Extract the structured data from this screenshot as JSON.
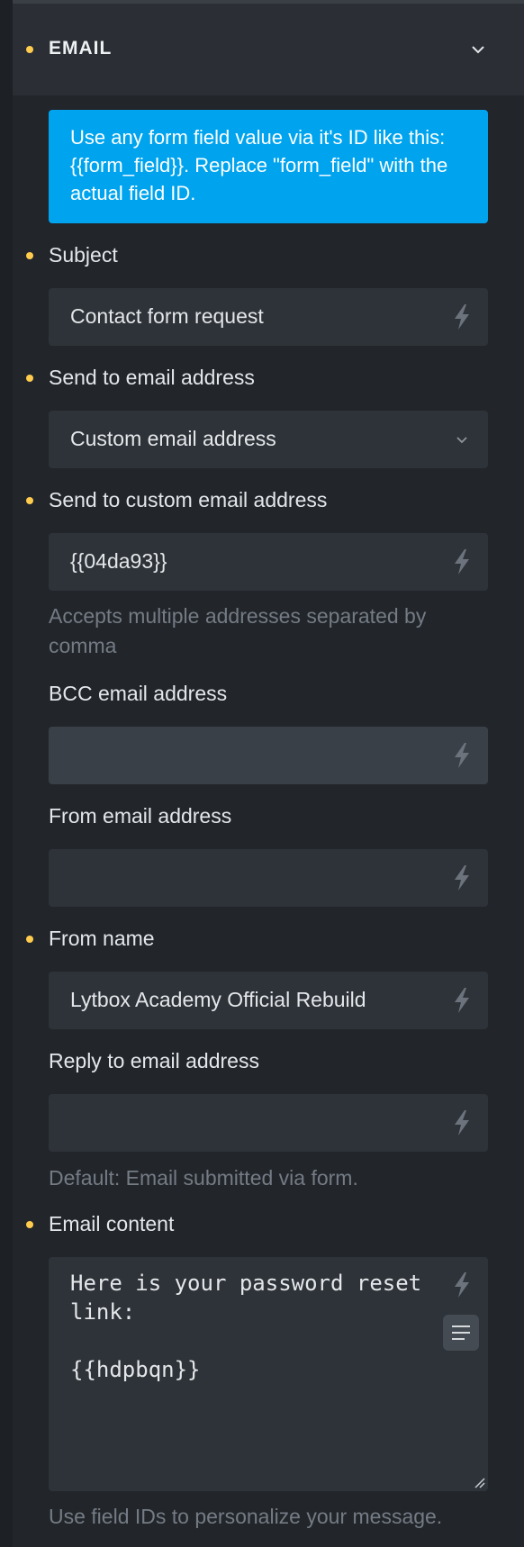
{
  "section": {
    "title": "EMAIL"
  },
  "info_text": "Use any form field value via it's ID like this: {{form_field}}. Replace \"form_field\" with the actual field ID.",
  "fields": {
    "subject": {
      "label": "Subject",
      "value": "Contact form request"
    },
    "send_to": {
      "label": "Send to email address",
      "value": "Custom email address"
    },
    "custom_to": {
      "label": "Send to custom email address",
      "value": "{{04da93}}",
      "help": "Accepts multiple addresses separated by comma"
    },
    "bcc": {
      "label": "BCC email address",
      "value": ""
    },
    "from_email": {
      "label": "From email address",
      "value": ""
    },
    "from_name": {
      "label": "From name",
      "value": "Lytbox Academy Official Rebuild"
    },
    "reply_to": {
      "label": "Reply to email address",
      "value": "",
      "help": "Default: Email submitted via form."
    },
    "content": {
      "label": "Email content",
      "value": "Here is your password reset link:\n\n{{hdpbqn}}",
      "help": "Use field IDs to personalize your message."
    }
  },
  "colors": {
    "accent": "#00a4ee",
    "required_dot": "#ffcc4d",
    "panel_bg": "#22262b",
    "input_bg": "#2e3339"
  },
  "icons": {
    "dynamic_data": "bolt-icon",
    "collapse": "chevron-down-icon",
    "format": "text-format-icon"
  }
}
